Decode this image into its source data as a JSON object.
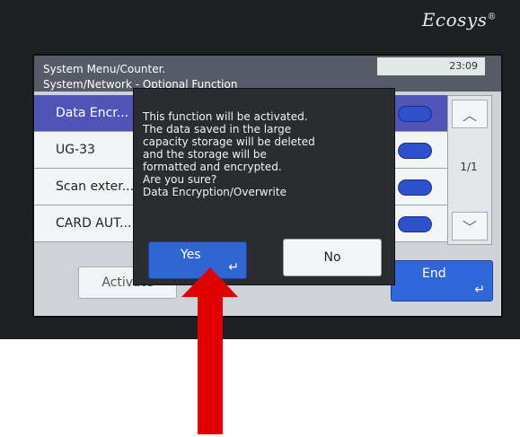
{
  "brand": "Ecosys",
  "header": {
    "line1": "System Menu/Counter.",
    "line2": "System/Network - Optional Function",
    "time": "23:09"
  },
  "list": {
    "items": [
      {
        "label": "Data Encr..."
      },
      {
        "label": "UG-33"
      },
      {
        "label": "Scan exter..."
      },
      {
        "label": "CARD AUT..."
      }
    ],
    "page": "1/1"
  },
  "footer": {
    "activate_label": "Activate",
    "end_label": "End"
  },
  "dialog": {
    "lines": [
      "This function will be activated.",
      "The data saved in the large",
      "capacity storage will be deleted",
      "and the storage will be",
      "formatted and encrypted.",
      "Are you sure?",
      "Data Encryption/Overwrite"
    ],
    "yes_label": "Yes",
    "no_label": "No"
  },
  "colors": {
    "accent": "#2f66d2",
    "annotation_arrow": "#e00000"
  }
}
